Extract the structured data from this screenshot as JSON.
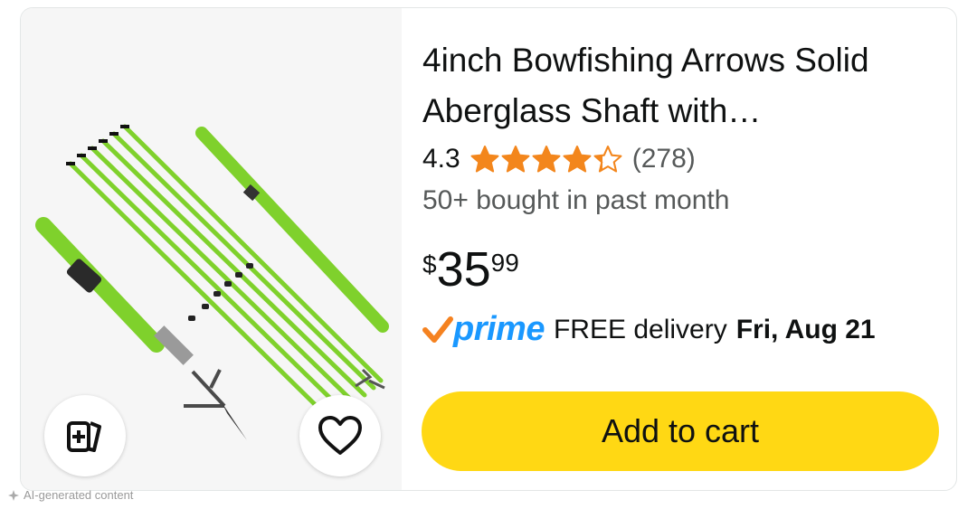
{
  "product": {
    "title": "4inch Bowfishing Arrows Solid\nAberglass Shaft with…",
    "rating": "4.3",
    "stars_value": 4.3,
    "review_count": "(278)",
    "bought_text": "50+ bought in past month",
    "price_symbol": "$",
    "price_whole": "35",
    "price_fraction": "99",
    "prime_label": "prime",
    "delivery_text": "FREE delivery",
    "delivery_date": "Fri, Aug 21",
    "add_to_cart_label": "Add to cart"
  },
  "image": {
    "compare_icon": "compare-cards-icon",
    "wishlist_icon": "heart-icon"
  },
  "footer": {
    "ai_note": "AI-generated content"
  },
  "colors": {
    "star": "#f3861c",
    "prime_blue": "#1a98ff",
    "prime_check": "#f58220",
    "add_button": "#ffd814",
    "arrow_green": "#7fd12c"
  }
}
